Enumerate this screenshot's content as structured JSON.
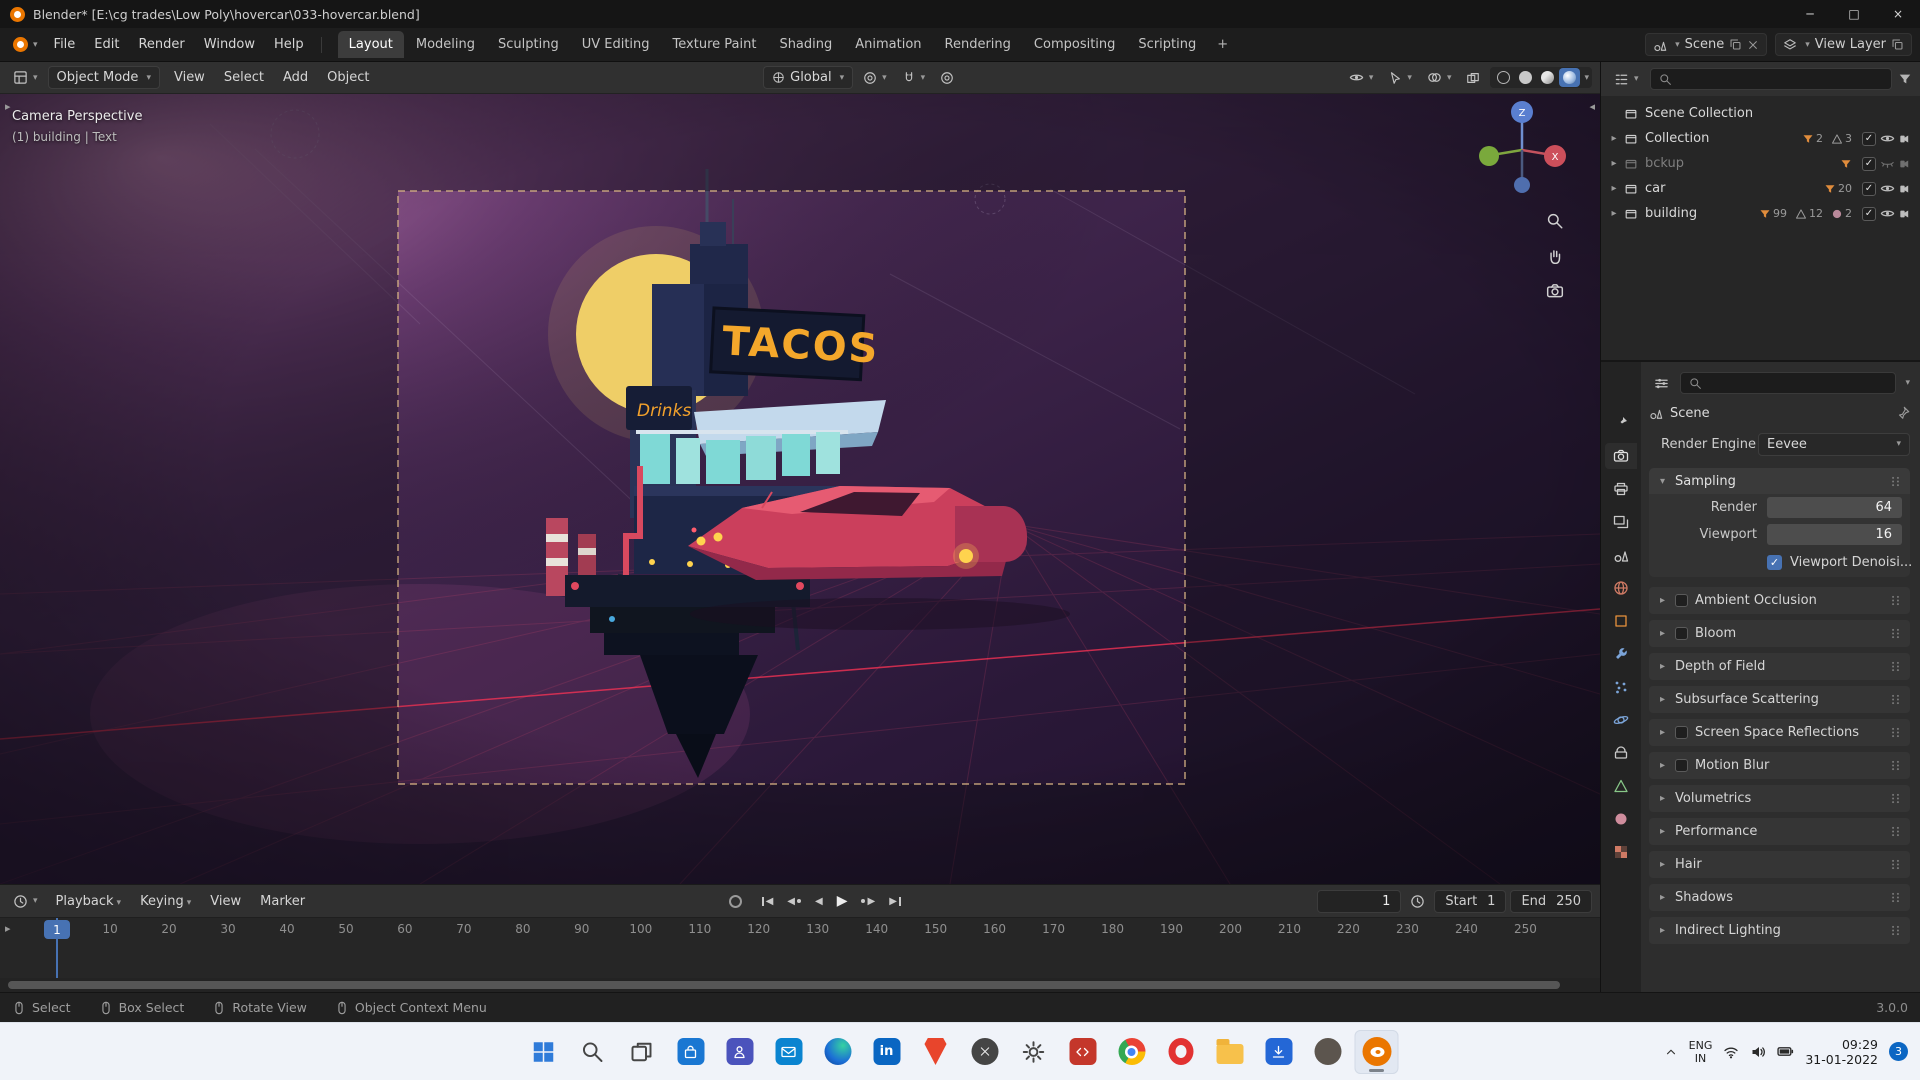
{
  "colors": {
    "accent": "#4772b3",
    "blender_orange": "#ea7600",
    "titlebar_bg": "#151515",
    "menubar_bg": "#1d1d1d",
    "header_bg": "#303030",
    "panel_bg": "#2d2d2d",
    "outliner_bg": "#262626",
    "field_bg": "#232323",
    "value_bg": "#4d4d4d",
    "section_bg": "#353535",
    "statusbar_bg": "#212121",
    "taskbar_bg": "#f0f3f9",
    "tray_badge": "#0b66c3",
    "text": "#d9d9d9",
    "sign_orange": "#f4a72b"
  },
  "title_bar": {
    "app_title": "Blender* [E:\\cg trades\\Low Poly\\hovercar\\033-hovercar.blend]"
  },
  "window_controls": {
    "minimize": "─",
    "maximize": "□",
    "close": "×"
  },
  "menu_bar": {
    "menus": [
      "File",
      "Edit",
      "Render",
      "Window",
      "Help"
    ],
    "workspaces": [
      "Layout",
      "Modeling",
      "Sculpting",
      "UV Editing",
      "Texture Paint",
      "Shading",
      "Animation",
      "Rendering",
      "Compositing",
      "Scripting"
    ],
    "active_workspace": "Layout",
    "add_workspace": "+",
    "scene_name": "Scene",
    "view_layer_name": "View Layer"
  },
  "viewport_header": {
    "mode": "Object Mode",
    "menus": [
      "View",
      "Select",
      "Add",
      "Object"
    ],
    "orientation": "Global"
  },
  "viewport": {
    "overlay_line1": "Camera Perspective",
    "overlay_line2": "(1) building | Text",
    "gizmo": {
      "z": "Z",
      "x": "X"
    },
    "scene_texts": {
      "sign": "TACOS",
      "drinks": "Drinks"
    }
  },
  "outliner": {
    "title": "Scene Collection",
    "rows": [
      {
        "name": "Scene Collection",
        "arrow": "",
        "controls": false,
        "badges": []
      },
      {
        "name": "Collection",
        "arrow": "▸",
        "controls": true,
        "eye": "open",
        "badges": [
          {
            "icon": "funnel",
            "count": "2"
          },
          {
            "icon": "mesh",
            "count": "3"
          }
        ]
      },
      {
        "name": "bckup",
        "arrow": "▸",
        "controls": true,
        "dimmed": true,
        "eye": "closed",
        "badges": [
          {
            "icon": "funnel",
            "count": ""
          }
        ]
      },
      {
        "name": "car",
        "arrow": "▸",
        "controls": true,
        "eye": "open",
        "badges": [
          {
            "icon": "funnel",
            "count": "20"
          }
        ]
      },
      {
        "name": "building",
        "arrow": "▸",
        "controls": true,
        "eye": "open",
        "badges": [
          {
            "icon": "funnel",
            "count": "99"
          },
          {
            "icon": "mesh",
            "count": "12"
          },
          {
            "icon": "material",
            "count": "2"
          }
        ]
      }
    ]
  },
  "properties": {
    "breadcrumb": "Scene",
    "render_engine_label": "Render Engine",
    "render_engine_value": "Eevee",
    "sampling_title": "Sampling",
    "sampling_rows": [
      {
        "label": "Render",
        "value": "64"
      },
      {
        "label": "Viewport",
        "value": "16"
      }
    ],
    "denoise_label": "Viewport Denoisi...",
    "tabs": [
      {
        "name": "tool"
      },
      {
        "name": "render",
        "active": true
      },
      {
        "name": "output"
      },
      {
        "name": "view-layer"
      },
      {
        "name": "scene"
      },
      {
        "name": "world"
      },
      {
        "name": "object"
      },
      {
        "name": "modifiers"
      },
      {
        "name": "particles"
      },
      {
        "name": "physics"
      },
      {
        "name": "constraints"
      },
      {
        "name": "object-data"
      },
      {
        "name": "material"
      },
      {
        "name": "texture"
      }
    ],
    "sections": [
      {
        "label": "Ambient Occlusion",
        "checkbox": true
      },
      {
        "label": "Bloom",
        "checkbox": true
      },
      {
        "label": "Depth of Field",
        "checkbox": false
      },
      {
        "label": "Subsurface Scattering",
        "checkbox": false
      },
      {
        "label": "Screen Space Reflections",
        "checkbox": true
      },
      {
        "label": "Motion Blur",
        "checkbox": true
      },
      {
        "label": "Volumetrics",
        "checkbox": false
      },
      {
        "label": "Performance",
        "checkbox": false
      },
      {
        "label": "Hair",
        "checkbox": false
      },
      {
        "label": "Shadows",
        "checkbox": false
      },
      {
        "label": "Indirect Lighting",
        "checkbox": false
      }
    ]
  },
  "timeline": {
    "menus": [
      {
        "label": "Playback",
        "caret": true
      },
      {
        "label": "Keying",
        "caret": true
      },
      {
        "label": "View",
        "caret": false
      },
      {
        "label": "Marker",
        "caret": false
      }
    ],
    "transport": [
      "jump-to-start",
      "prev-keyframe",
      "play-reverse",
      "play",
      "next-keyframe",
      "jump-to-end"
    ],
    "frame_field": "1",
    "playhead_frame": "1",
    "start_label": "Start",
    "start_value": "1",
    "end_label": "End",
    "end_value": "250",
    "tick_frames": [
      10,
      20,
      30,
      40,
      50,
      60,
      70,
      80,
      90,
      100,
      110,
      120,
      130,
      140,
      150,
      160,
      170,
      180,
      190,
      200,
      210,
      220,
      230,
      240,
      250
    ]
  },
  "status_bar": {
    "hints": [
      "Select",
      "Box Select",
      "Rotate View",
      "Object Context Menu"
    ],
    "version": "3.0.0"
  },
  "taskbar": {
    "icons": [
      {
        "name": "start-icon",
        "shape": "plain",
        "sym": "sym-windows",
        "color": "#2f7bd9"
      },
      {
        "name": "search-icon",
        "shape": "plain",
        "sym": "sym-magnifier",
        "color": "#454545"
      },
      {
        "name": "task-view-icon",
        "shape": "plain",
        "sym": "sym-taskview",
        "color": "#454545"
      },
      {
        "name": "store-icon",
        "shape": "square",
        "sym": "sym-bag",
        "color": "#1a77d2"
      },
      {
        "name": "teams-icon",
        "shape": "square",
        "sym": "sym-person",
        "color": "#4b53bc"
      },
      {
        "name": "mail-icon",
        "shape": "square",
        "sym": "sym-envelope",
        "color": "#0a84d0"
      },
      {
        "name": "edge-icon",
        "shape": "edge"
      },
      {
        "name": "linkedin-icon",
        "shape": "square",
        "label": "in",
        "color": "#0a66c2"
      },
      {
        "name": "brave-icon",
        "shape": "shield"
      },
      {
        "name": "xbox-icon",
        "shape": "circle",
        "sym": "sym-x",
        "color": "#454545"
      },
      {
        "name": "settings-icon",
        "shape": "plain",
        "sym": "sym-gear",
        "color": "#454545"
      },
      {
        "name": "code-app-icon",
        "shape": "square",
        "sym": "sym-code",
        "color": "#c4372b"
      },
      {
        "name": "chrome-icon",
        "shape": "chrome"
      },
      {
        "name": "opera-icon",
        "shape": "opera"
      },
      {
        "name": "file-explorer-icon",
        "shape": "folder"
      },
      {
        "name": "download-app-icon",
        "shape": "square",
        "sym": "sym-download",
        "color": "#2467d6"
      },
      {
        "name": "gimp-icon",
        "shape": "circle",
        "color": "#5c554e"
      },
      {
        "name": "blender-icon",
        "shape": "blender",
        "active": true
      }
    ],
    "lang1": "ENG",
    "lang2": "IN",
    "time": "09:29",
    "date": "31-01-2022",
    "badge": "3"
  }
}
